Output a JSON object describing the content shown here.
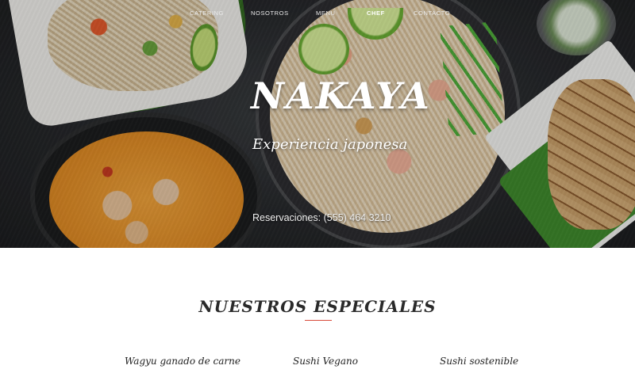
{
  "nav": {
    "items": [
      {
        "label": "CATERING"
      },
      {
        "label": "NOSOTROS"
      },
      {
        "label": "MENU"
      },
      {
        "label": "CHEF"
      },
      {
        "label": "CONTACTO"
      }
    ]
  },
  "hero": {
    "title": "NAKAYA",
    "subtitle": "Experiencia japonesa",
    "reservations": "Reservaciones: (555) 464 3210"
  },
  "specials": {
    "title": "NUESTROS ESPECIALES",
    "items": [
      {
        "name": "Wagyu ganado de carne"
      },
      {
        "name": "Sushi Vegano"
      },
      {
        "name": "Sushi sostenible"
      }
    ]
  },
  "colors": {
    "accent_rule": "#d84a3a",
    "hero_text": "#ffffff",
    "heading_text": "#2a2a2a"
  }
}
